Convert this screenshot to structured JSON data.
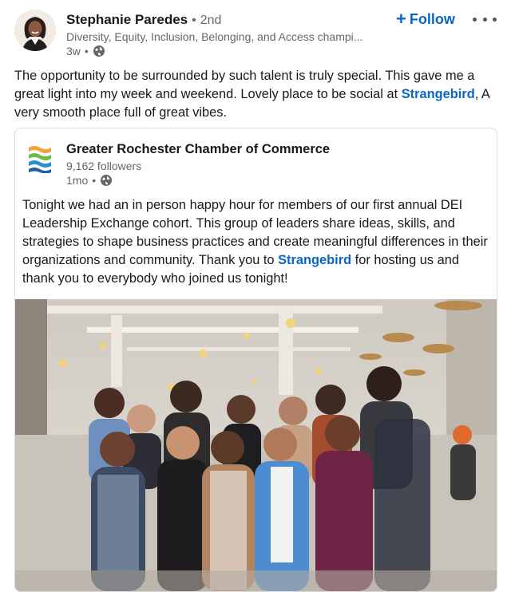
{
  "author": {
    "name": "Stephanie Paredes",
    "degree": "2nd",
    "headline": "Diversity, Equity, Inclusion, Belonging, and Access champi...",
    "time": "3w",
    "visibility_icon": "globe-icon"
  },
  "actions": {
    "follow_label": "Follow",
    "follow_icon": "plus-icon",
    "more_icon": "more-options-icon"
  },
  "post": {
    "text_before": "The opportunity to be surrounded by such talent is truly special. This gave me a great light into my week and weekend. Lovely place to be social at ",
    "mention": "Strangebird",
    "text_after": ", A very smooth place full of great vibes."
  },
  "shared_post": {
    "org_name": "Greater Rochester Chamber of Commerce",
    "followers": "9,162 followers",
    "time": "1mo",
    "visibility_icon": "globe-icon",
    "text_before": "Tonight we had an in person happy hour for members of our first annual DEI Leadership Exchange cohort. This group of leaders share ideas, skills, and strategies to shape business practices and create meaningful differences in their organizations and community. Thank you to ",
    "mention": "Strangebird",
    "text_after": " for hosting us and thank you to everybody who joined us tonight!"
  },
  "colors": {
    "link_blue": "#0a66c2",
    "secondary_text": "#666666",
    "primary_text": "#191919"
  }
}
